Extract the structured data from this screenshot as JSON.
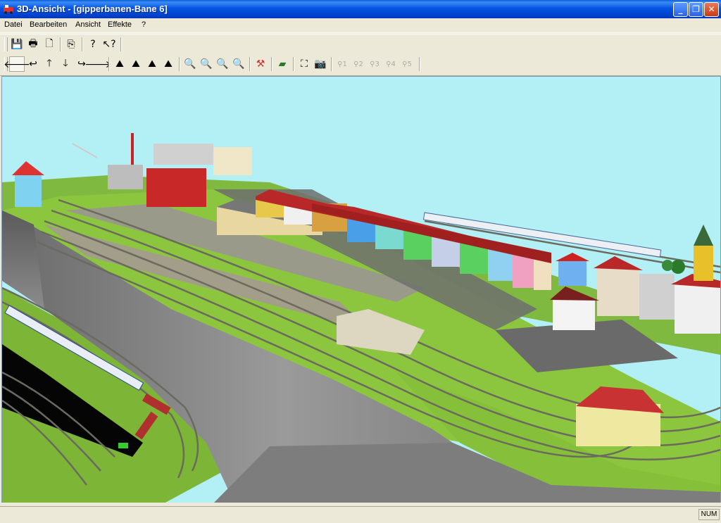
{
  "window": {
    "title": "3D-Ansicht - [gipperbanen-Bane 6]"
  },
  "menu": [
    {
      "label": "Datei"
    },
    {
      "label": "Bearbeiten"
    },
    {
      "label": "Ansicht"
    },
    {
      "label": "Effekte"
    },
    {
      "label": "?"
    }
  ],
  "toolbar1": [
    "save-icon",
    "print-icon",
    "print-preview-icon",
    "copy-icon",
    "help-icon",
    "context-help-icon"
  ],
  "toolbar2": {
    "nav": [
      "arrow-left-icon",
      "turn-left-icon",
      "arrow-up-icon",
      "arrow-down-icon",
      "turn-right-icon",
      "arrow-right-icon"
    ],
    "camera": [
      "camera-tilt-up-icon",
      "camera-tilt-left-icon",
      "camera-tilt-right-icon",
      "camera-tilt-down-icon"
    ],
    "zoom": [
      "zoom-out-far-icon",
      "zoom-out-icon",
      "zoom-in-icon",
      "zoom-in-far-icon"
    ],
    "tools": [
      "track-tool-icon",
      "landscape-icon",
      "fit-view-icon",
      "snapshot-icon"
    ],
    "views": [
      {
        "label": "1",
        "enabled": false
      },
      {
        "label": "2",
        "enabled": false
      },
      {
        "label": "3",
        "enabled": false
      },
      {
        "label": "4",
        "enabled": false
      },
      {
        "label": "5",
        "enabled": false
      }
    ]
  },
  "status": {
    "num": "NUM"
  },
  "colors": {
    "sky": "#b3f0f5",
    "grass": "#8cc63f",
    "cliff": "#8a8a8a",
    "track": "#6b6a5e"
  }
}
